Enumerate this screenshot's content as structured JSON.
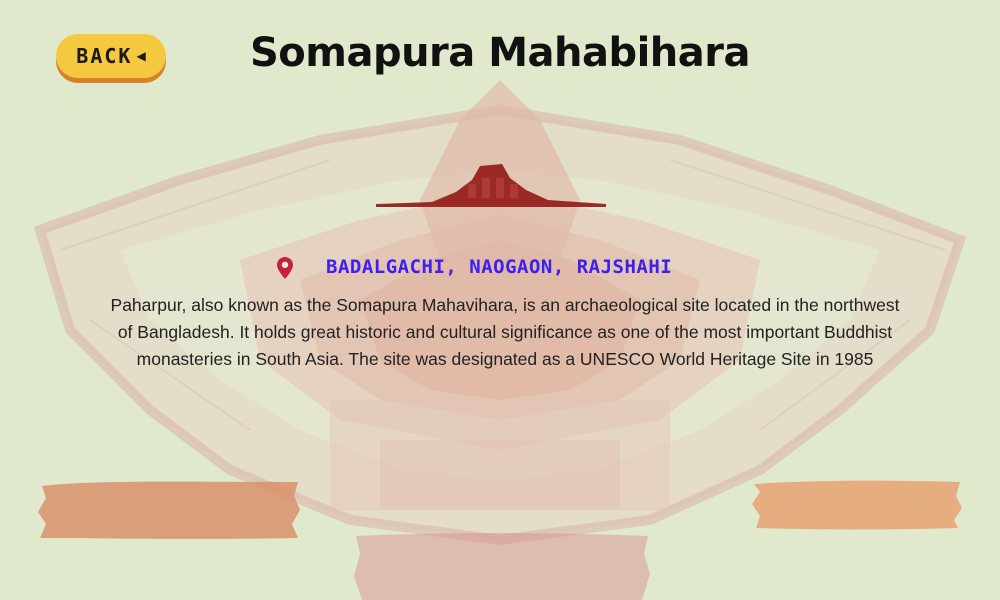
{
  "header": {
    "back_label": "BACK",
    "back_icon": "triangle-left-icon",
    "title": "Somapura Mahabihara"
  },
  "location": {
    "icon": "map-pin-icon",
    "text": "BADALGACHI, NAOGAON, RAJSHAHI"
  },
  "description": "Paharpur, also known as the Somapura Mahavihara, is an archaeological site located in the northwest of Bangladesh. It holds great historic and cultural significance as one of the most important Buddhist monasteries in South Asia. The site was designated as a UNESCO World Heritage Site in 1985",
  "colors": {
    "back_button": "#f5c93f",
    "back_shadow": "#d9802a",
    "location_text": "#3d20f0",
    "pin": "#c8203a",
    "monument": "#9b2a24",
    "brush_left": "#d8916b",
    "brush_right": "#e5a272",
    "brush_bottom": "#d98a8a"
  }
}
